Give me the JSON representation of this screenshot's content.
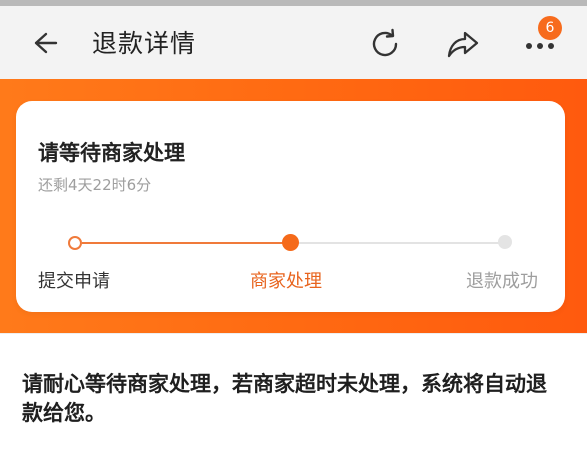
{
  "header": {
    "title": "退款详情",
    "back_icon": "back-arrow-icon",
    "refresh_icon": "refresh-icon",
    "share_icon": "share-icon",
    "more_icon": "more-dots-icon",
    "badge_count": "6"
  },
  "status": {
    "title": "请等待商家处理",
    "remaining": "还剩4天22时6分"
  },
  "progress": {
    "steps": [
      {
        "label": "提交申请",
        "state": "done"
      },
      {
        "label": "商家处理",
        "state": "current"
      },
      {
        "label": "退款成功",
        "state": "pending"
      }
    ]
  },
  "notice": "请耐心等待商家处理，若商家超时未处理，系统将自动退款给您。",
  "colors": {
    "accent": "#ff6a12",
    "active_step": "#e8641e",
    "badge": "#f76b1c"
  }
}
